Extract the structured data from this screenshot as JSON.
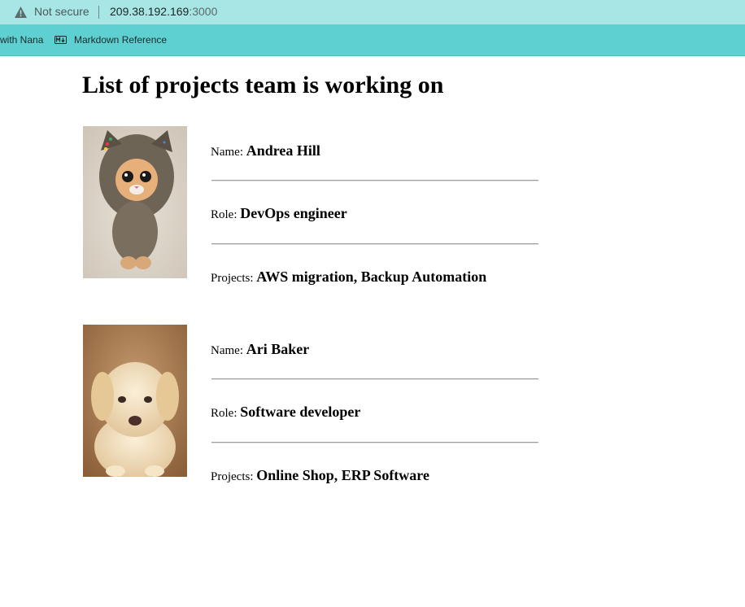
{
  "browser": {
    "security_label": "Not secure",
    "url_host": "209.38.192.169",
    "url_port": ":3000",
    "bookmarks": [
      {
        "label": "with Nana"
      },
      {
        "label": "Markdown Reference"
      }
    ]
  },
  "page": {
    "title": "List of projects team is working on"
  },
  "members": [
    {
      "name_label": "Name:",
      "name": "Andrea Hill",
      "role_label": "Role:",
      "role": "DevOps engineer",
      "projects_label": "Projects:",
      "projects": "AWS migration, Backup Automation",
      "photo_icon": "kitten-photo"
    },
    {
      "name_label": "Name:",
      "name": "Ari Baker",
      "role_label": "Role:",
      "role": "Software developer",
      "projects_label": "Projects:",
      "projects": "Online Shop, ERP Software",
      "photo_icon": "puppy-photo"
    }
  ]
}
